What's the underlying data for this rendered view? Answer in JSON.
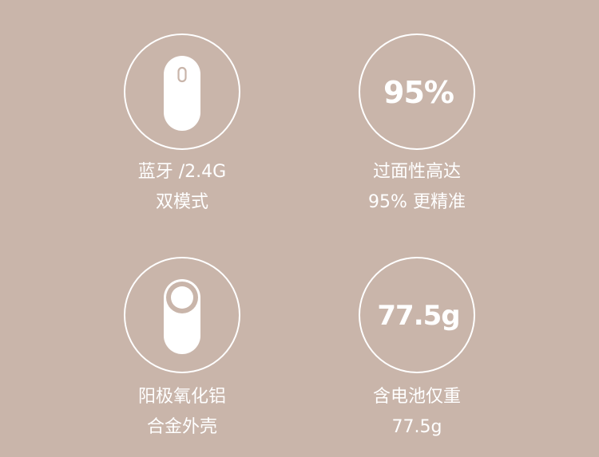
{
  "features": [
    {
      "line1": "蓝牙 /2.4G",
      "line2": "双模式",
      "icon": "mouse-icon"
    },
    {
      "value": "95%",
      "line1": "过面性高达",
      "line2": "95% 更精准"
    },
    {
      "line1": "阳极氧化铝",
      "line2": "合金外壳",
      "icon": "aluminum-shell-icon"
    },
    {
      "value": "77.5g",
      "line1": "含电池仅重",
      "line2": "77.5g"
    }
  ],
  "colors": {
    "background": "#c9b5aa",
    "foreground": "#ffffff"
  }
}
